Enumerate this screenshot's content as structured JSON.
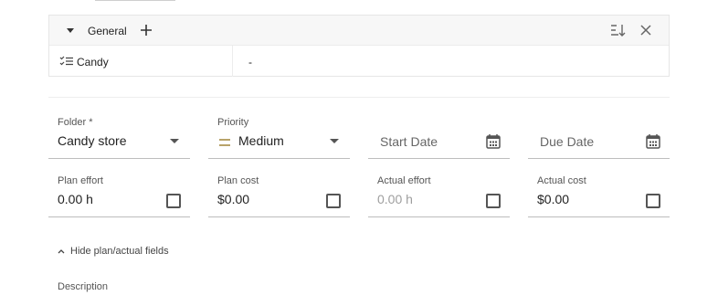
{
  "general": {
    "title": "General",
    "rows": [
      {
        "name": "Candy",
        "value": "-"
      }
    ]
  },
  "fields": {
    "folder": {
      "label": "Folder *",
      "value": "Candy store"
    },
    "priority": {
      "label": "Priority",
      "value": "Medium",
      "icon_color": "#b8a36a"
    },
    "start_date": {
      "placeholder": "Start Date"
    },
    "due_date": {
      "placeholder": "Due Date"
    },
    "plan_effort": {
      "label": "Plan effort",
      "value": "0.00 h"
    },
    "plan_cost": {
      "label": "Plan cost",
      "value": "$0.00"
    },
    "actual_effort": {
      "label": "Actual effort",
      "value": "0.00 h"
    },
    "actual_cost": {
      "label": "Actual cost",
      "value": "$0.00"
    }
  },
  "toggle": {
    "label": "Hide plan/actual fields"
  },
  "description": {
    "label": "Description"
  }
}
